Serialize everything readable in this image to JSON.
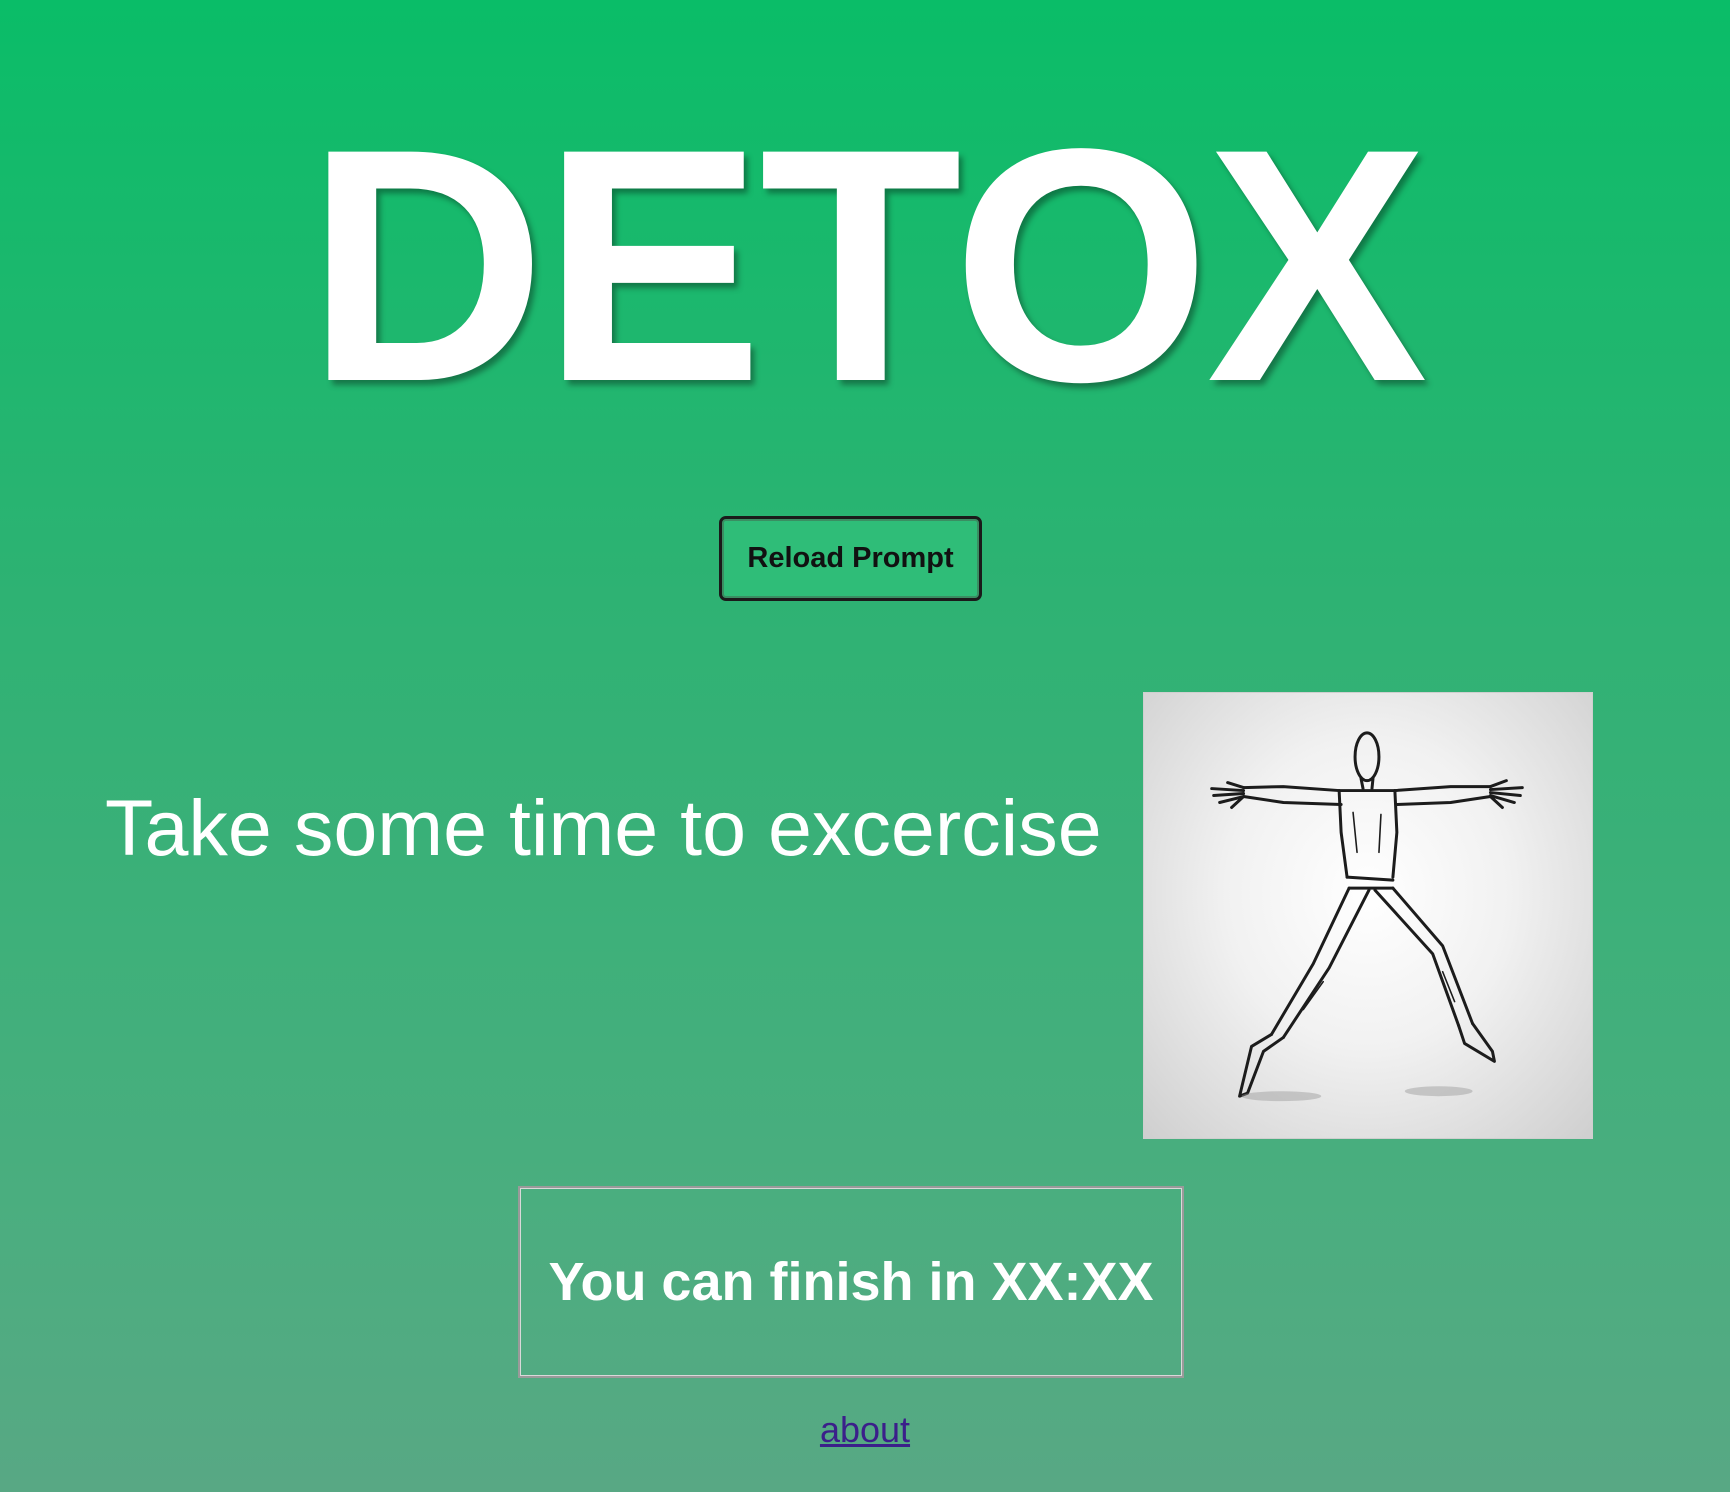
{
  "header": {
    "title": "DETOX"
  },
  "controls": {
    "reload_label": "Reload Prompt"
  },
  "prompt": {
    "text": "Take some time to excercise",
    "image_icon": "exercise-sketch-image"
  },
  "timer": {
    "text": "You can finish in XX:XX"
  },
  "footer": {
    "about_label": "about"
  },
  "colors": {
    "background_top": "#0abd68",
    "background_bottom": "#58a884",
    "button_fill": "#2fbd78",
    "link": "#3b1f8a",
    "text": "#ffffff"
  }
}
